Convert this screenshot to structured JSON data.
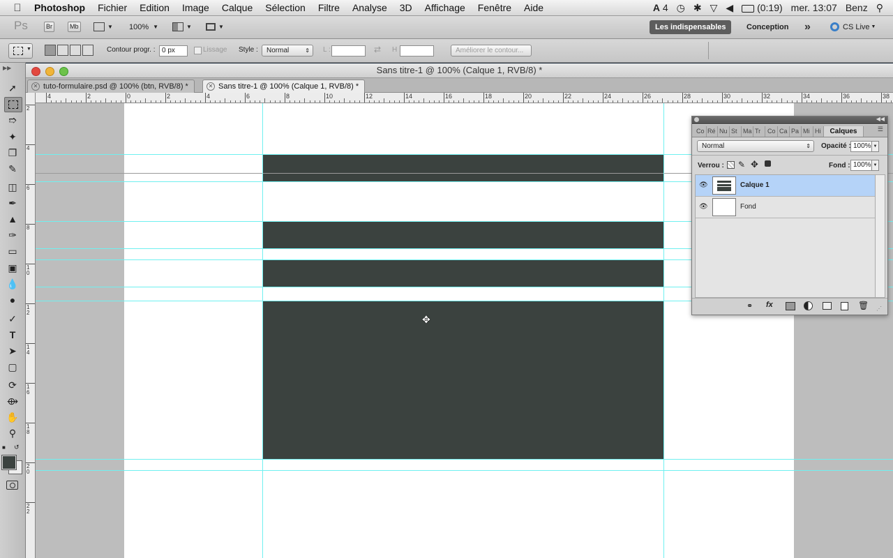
{
  "menubar": {
    "apple": "",
    "items": [
      "Photoshop",
      "Fichier",
      "Edition",
      "Image",
      "Calque",
      "Sélection",
      "Filtre",
      "Analyse",
      "3D",
      "Affichage",
      "Fenêtre",
      "Aide"
    ],
    "status": {
      "adobe_count": "4",
      "battery": "(0:19)",
      "clock": "mer. 13:07",
      "user": "Benz"
    }
  },
  "appbar": {
    "ps": "Ps",
    "br": "Br",
    "mb": "Mb",
    "zoom": "100%",
    "workspace_active": "Les indispensables",
    "workspace_other": "Conception",
    "more": "»",
    "cslive": "CS Live"
  },
  "options": {
    "feather_label": "Contour progr. :",
    "feather_value": "0 px",
    "antialias_label": "Lissage",
    "style_label": "Style :",
    "style_value": "Normal",
    "width_label": "L :",
    "height_label": "H :",
    "refine_label": "Améliorer le contour..."
  },
  "document": {
    "title": "Sans titre-1 @ 100% (Calque 1, RVB/8) *",
    "tabs": [
      {
        "label": "tuto-formulaire.psd @ 100% (btn, RVB/8) *",
        "active": false
      },
      {
        "label": "Sans titre-1 @ 100% (Calque 1, RVB/8) *",
        "active": true
      }
    ],
    "hruler_labels": [
      "4",
      "2",
      "0",
      "2",
      "4",
      "6",
      "8",
      "10",
      "12",
      "14",
      "16",
      "18",
      "20",
      "22",
      "24",
      "26",
      "28",
      "30",
      "32",
      "34",
      "36",
      "38"
    ],
    "vruler_labels": [
      "2",
      "4",
      "6",
      "8",
      "1\n0",
      "1\n2",
      "1\n4",
      "1\n6",
      "1\n8",
      "2\n0",
      "2\n2"
    ]
  },
  "layers": {
    "tabs": [
      "Co",
      "Ré",
      "Nu",
      "St",
      "Ma",
      "Tr",
      "Co",
      "Ca",
      "Pa",
      "Mi",
      "Hi",
      "Calques"
    ],
    "blend_mode": "Normal",
    "opacity_label": "Opacité :",
    "opacity_value": "100%",
    "lock_label": "Verrou :",
    "fill_label": "Fond :",
    "fill_value": "100%",
    "rows": [
      {
        "name": "Calque 1",
        "selected": true
      },
      {
        "name": "Fond",
        "selected": false
      }
    ]
  },
  "colors": {
    "fill": "#3b423f",
    "guide": "#6ff0f0",
    "selected_layer": "#b5d3f8"
  }
}
